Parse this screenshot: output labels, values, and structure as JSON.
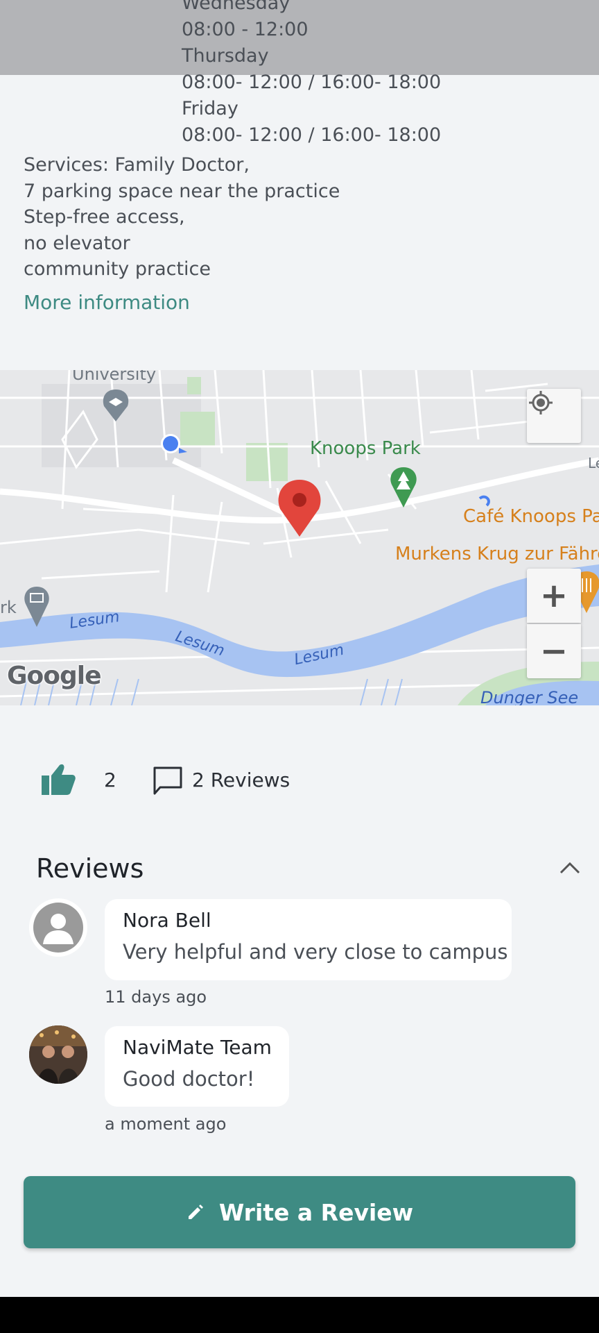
{
  "hours": [
    {
      "day": "Wednesday",
      "time": "08:00 - 12:00"
    },
    {
      "day": "Thursday",
      "time": "08:00- 12:00 / 16:00- 18:00"
    },
    {
      "day": "Friday",
      "time": "08:00- 12:00 / 16:00- 18:00"
    }
  ],
  "services": [
    "Services: Family Doctor,",
    "7 parking space near the practice",
    "Step-free access,",
    "no elevator",
    "community practice"
  ],
  "more_info_label": "More information",
  "map": {
    "labels": {
      "university": "University",
      "knoops_park": "Knoops Park",
      "cafe": "Café Knoops Pa",
      "murkens": "Murkens Krug zur Fähre",
      "lesum_1": "Lesum",
      "lesum_2": "Lesum",
      "lesum_3": "Lesum",
      "dunger_see": "Dunger See",
      "ark": "rk",
      "le": "Le"
    },
    "attribution": "Google",
    "zoom_in": "+",
    "zoom_out": "−",
    "colors": {
      "water": "#a7c3f2",
      "park": "#c8e3c3",
      "road": "#ffffff",
      "marker": "#e2453c",
      "poi_orange": "#e0891c",
      "poi_green": "#3f8f4b"
    }
  },
  "stats": {
    "likes": "2",
    "reviews_label": "2 Reviews"
  },
  "reviews_section": {
    "title": "Reviews",
    "items": [
      {
        "author": "Nora Bell",
        "text": "Very helpful and very close to campus",
        "time": "11 days ago"
      },
      {
        "author": "NaviMate Team",
        "text": "Good doctor!",
        "time": "a moment ago"
      }
    ]
  },
  "write_review_label": "Write a Review",
  "colors": {
    "accent": "#3e8b83",
    "background": "#f2f4f6",
    "text": "#4a4f56"
  }
}
